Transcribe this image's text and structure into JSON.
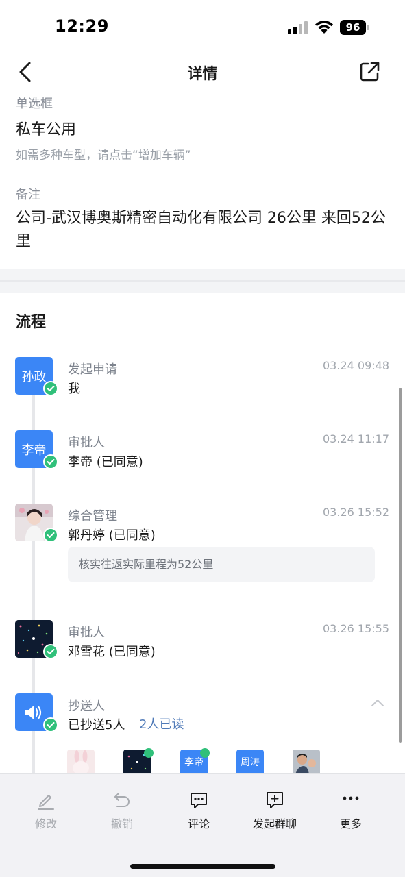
{
  "status": {
    "time": "12:29",
    "battery": "96"
  },
  "nav": {
    "title": "详情"
  },
  "fields": {
    "radio_label": "单选框",
    "radio_value": "私车公用",
    "radio_hint": "如需多种车型，请点击“增加车辆”",
    "remark_label": "备注",
    "remark_value": "公司-武汉博奥斯精密自动化有限公司 26公里 来回52公里"
  },
  "process": {
    "title": "流程",
    "steps": [
      {
        "role": "发起申请",
        "name": "我",
        "time": "03.24 09:48",
        "avatar_text": "孙政"
      },
      {
        "role": "审批人",
        "name": "李帝 (已同意)",
        "time": "03.24 11:17",
        "avatar_text": "李帝"
      },
      {
        "role": "综合管理",
        "name": "郭丹婷 (已同意)",
        "time": "03.26 15:52",
        "comment": "核实往返实际里程为52公里"
      },
      {
        "role": "审批人",
        "name": "邓雪花 (已同意)",
        "time": "03.26 15:55"
      },
      {
        "role": "抄送人",
        "name": "已抄送5人",
        "read": "2人已读"
      }
    ],
    "cc_avatars": [
      {
        "text": ""
      },
      {
        "text": ""
      },
      {
        "text": "李帝"
      },
      {
        "text": "周涛"
      },
      {
        "text": ""
      }
    ]
  },
  "toolbar": {
    "edit": "修改",
    "revoke": "撤销",
    "comment": "评论",
    "group_chat": "发起群聊",
    "more": "更多"
  },
  "colors": {
    "accent": "#3b86f6",
    "check": "#30c07a",
    "link": "#4f7ab8"
  }
}
